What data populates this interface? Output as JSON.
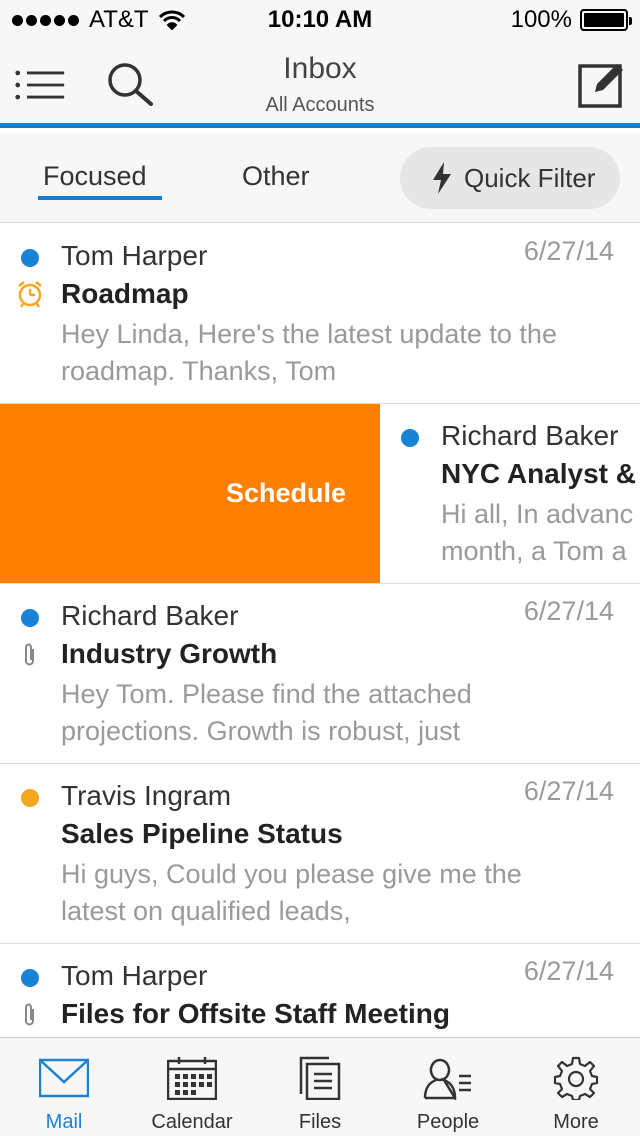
{
  "status_bar": {
    "carrier": "AT&T",
    "time": "10:10 AM",
    "battery": "100%",
    "signal_icon": "signal-dots-icon",
    "wifi_icon": "wifi-icon",
    "battery_icon": "battery-icon"
  },
  "header": {
    "title": "Inbox",
    "subtitle": "All Accounts",
    "menu_icon": "menu-list-icon",
    "search_icon": "search-icon",
    "compose_icon": "compose-icon"
  },
  "filter_tabs": {
    "focused": "Focused",
    "other": "Other",
    "quick_filter": "Quick Filter",
    "quick_filter_icon": "lightning-icon",
    "active": "Focused"
  },
  "colors": {
    "accent": "#0f7fd6",
    "unread_blue": "#1a82d4",
    "unread_orange": "#f5a623",
    "schedule": "#ff7f00",
    "reminder": "#f5a623"
  },
  "messages": [
    {
      "sender": "Tom Harper",
      "subject": "Roadmap",
      "preview": "Hey Linda, Here's the latest update to the roadmap. Thanks, Tom",
      "date": "6/27/14",
      "indicator": "unread-blue",
      "side_icon": "clock-icon"
    },
    {
      "sender": "Richard Baker",
      "subject": "NYC Analyst &",
      "preview_line1": "Hi all, In advanc",
      "preview_line2": "month, a Tom a",
      "indicator": "unread-blue",
      "swipe_action": "Schedule"
    },
    {
      "sender": "Richard Baker",
      "subject": "Industry Growth",
      "preview": "Hey Tom. Please find the attached projections. Growth is robust, just",
      "date": "6/27/14",
      "indicator": "unread-blue",
      "side_icon": "paperclip-icon"
    },
    {
      "sender": "Travis Ingram",
      "subject": "Sales Pipeline Status",
      "preview": "Hi guys, Could you please give me the latest on qualified leads,",
      "date": "6/27/14",
      "indicator": "unread-orange"
    },
    {
      "sender": "Tom Harper",
      "subject": "Files for Offsite Staff Meeting",
      "date": "6/27/14",
      "indicator": "unread-blue",
      "side_icon": "paperclip-icon"
    }
  ],
  "tab_bar": {
    "active": "Mail",
    "items": [
      {
        "label": "Mail",
        "icon": "mail-icon"
      },
      {
        "label": "Calendar",
        "icon": "calendar-icon"
      },
      {
        "label": "Files",
        "icon": "files-icon"
      },
      {
        "label": "People",
        "icon": "people-icon"
      },
      {
        "label": "More",
        "icon": "gear-icon"
      }
    ]
  }
}
